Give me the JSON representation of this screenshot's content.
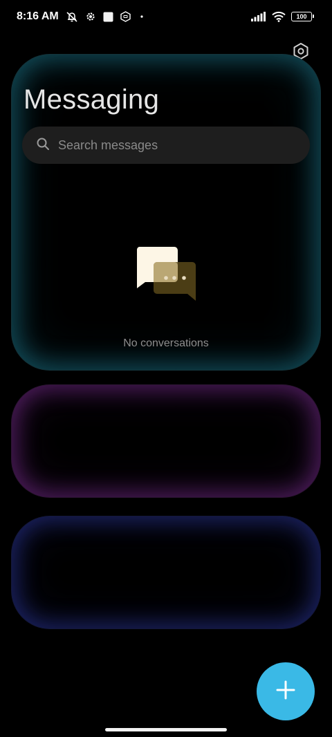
{
  "status_bar": {
    "time": "8:16 AM",
    "battery": "100",
    "icons": [
      "alarm-off-icon",
      "settings-gear-icon",
      "square-notification-icon",
      "hexagon-app-icon",
      "dot-icon",
      "cellular-signal-icon",
      "wifi-icon",
      "battery-icon"
    ]
  },
  "header": {
    "title": "Messaging",
    "settings_icon": "settings-icon"
  },
  "search": {
    "placeholder": "Search messages",
    "icon": "search-icon"
  },
  "empty_state": {
    "message": "No conversations",
    "illustration": "chat-bubbles-icon"
  },
  "fab": {
    "icon": "plus-icon"
  },
  "colors": {
    "background": "#000000",
    "accent": "#3ab9e6",
    "card_teal_glow": "#1e788c",
    "card_purple_glow": "#6e2882",
    "card_blue_glow": "#28328c",
    "bubble_front": "#fdf6e6",
    "bubble_back": "#5c4a1a"
  }
}
